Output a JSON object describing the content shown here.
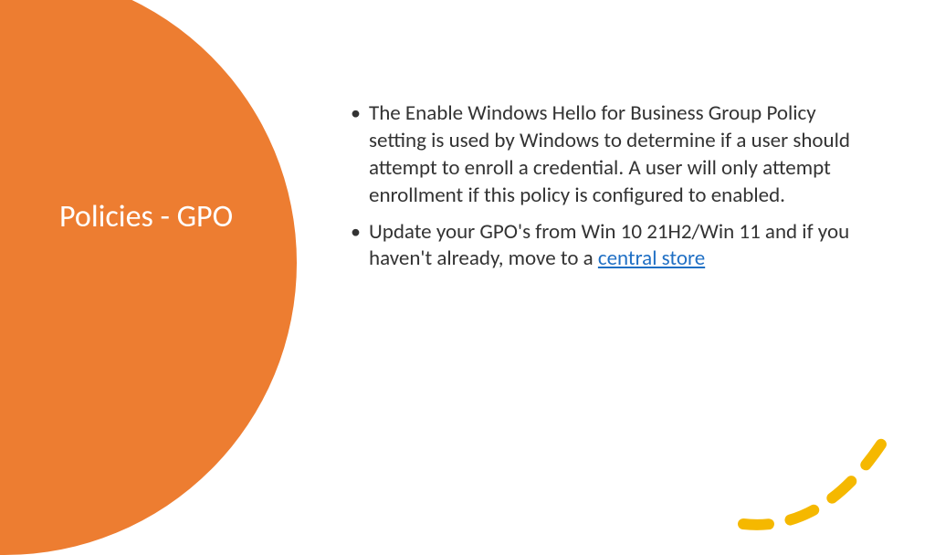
{
  "title": "Policies - GPO",
  "bullets": [
    {
      "text": "The Enable Windows Hello for Business Group Policy setting is used by Windows to determine if a user should attempt to enroll a credential. A user will only attempt enrollment if this policy is configured to enabled."
    },
    {
      "text_prefix": "Update your GPO's from Win 10 21H2/Win 11 and if you haven't already, move to a ",
      "link_text": "central store"
    }
  ],
  "colors": {
    "accent_orange": "#ED7D31",
    "accent_yellow": "#F5B800",
    "link": "#1F6FC4"
  }
}
